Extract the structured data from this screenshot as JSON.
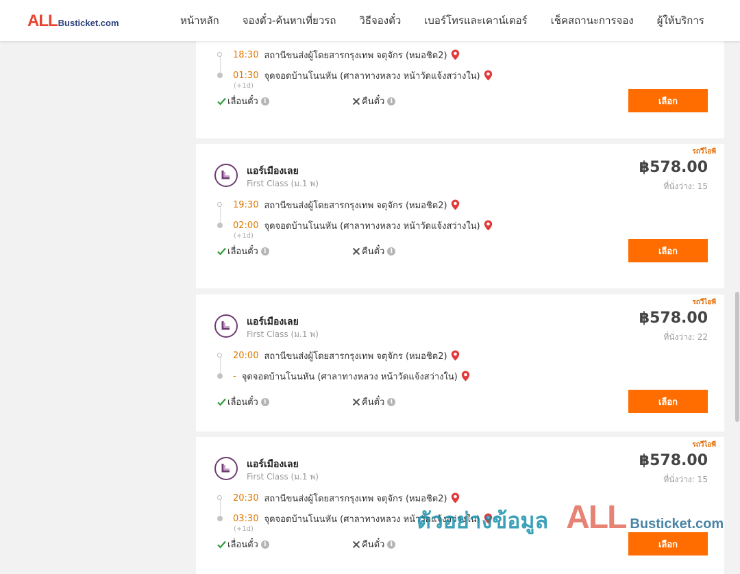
{
  "header": {
    "logo_all": "ALL",
    "logo_rest": "Busticket.com",
    "nav": [
      "หน้าหลัก",
      "จองตั๋ว-ค้นหาเที่ยวรถ",
      "วิธีจองตั๋ว",
      "เบอร์โทรและเคาน์เตอร์",
      "เช็คสถานะการจอง",
      "ผู้ให้บริการ"
    ]
  },
  "labels": {
    "vip": "รถวีไอพี",
    "seats_prefix": "ที่นั่งว่าง:",
    "reschedule": "เลื่อนตั๋ว",
    "refund": "คืนตั๋ว",
    "select": "เลือก",
    "next_day": "(+1d)"
  },
  "trips": [
    {
      "operator": "",
      "class": "",
      "price": "",
      "seats": "",
      "depart_time": "18:30",
      "depart_place": "สถานีขนส่งผู้โดยสารกรุงเทพ จตุจักร (หมอชิต2)",
      "arrive_time": "01:30",
      "arrive_place": "จุดจอดบ้านโนนหัน (ศาลาทางหลวง หน้าวัดแจ้งสว่างใน)",
      "next_day": true,
      "reschedule": true,
      "refund": false
    },
    {
      "operator": "แอร์เมืองเลย",
      "class": "First Class (ม.1 พ)",
      "price": "฿578.00",
      "seats": "15",
      "depart_time": "19:30",
      "depart_place": "สถานีขนส่งผู้โดยสารกรุงเทพ จตุจักร (หมอชิต2)",
      "arrive_time": "02:00",
      "arrive_place": "จุดจอดบ้านโนนหัน (ศาลาทางหลวง หน้าวัดแจ้งสว่างใน)",
      "next_day": true,
      "reschedule": true,
      "refund": false
    },
    {
      "operator": "แอร์เมืองเลย",
      "class": "First Class (ม.1 พ)",
      "price": "฿578.00",
      "seats": "22",
      "depart_time": "20:00",
      "depart_place": "สถานีขนส่งผู้โดยสารกรุงเทพ จตุจักร (หมอชิต2)",
      "arrive_time": "-",
      "arrive_place": "จุดจอดบ้านโนนหัน (ศาลาทางหลวง หน้าวัดแจ้งสว่างใน)",
      "next_day": false,
      "reschedule": true,
      "refund": false
    },
    {
      "operator": "แอร์เมืองเลย",
      "class": "First Class (ม.1 พ)",
      "price": "฿578.00",
      "seats": "15",
      "depart_time": "20:30",
      "depart_place": "สถานีขนส่งผู้โดยสารกรุงเทพ จตุจักร (หมอชิต2)",
      "arrive_time": "03:30",
      "arrive_place": "จุดจอดบ้านโนนหัน (ศาลาทางหลวง หน้าวัดแจ้งสว่างใน)",
      "next_day": true,
      "reschedule": true,
      "refund": false
    }
  ],
  "watermark": {
    "thai": "ตัวอย่างข้อมูล",
    "all": "ALL",
    "rest": "Busticket.com"
  },
  "colors": {
    "accent": "#ff6d00",
    "time": "#e07800",
    "check": "#2e9c3a",
    "pin": "#e23a3a"
  }
}
